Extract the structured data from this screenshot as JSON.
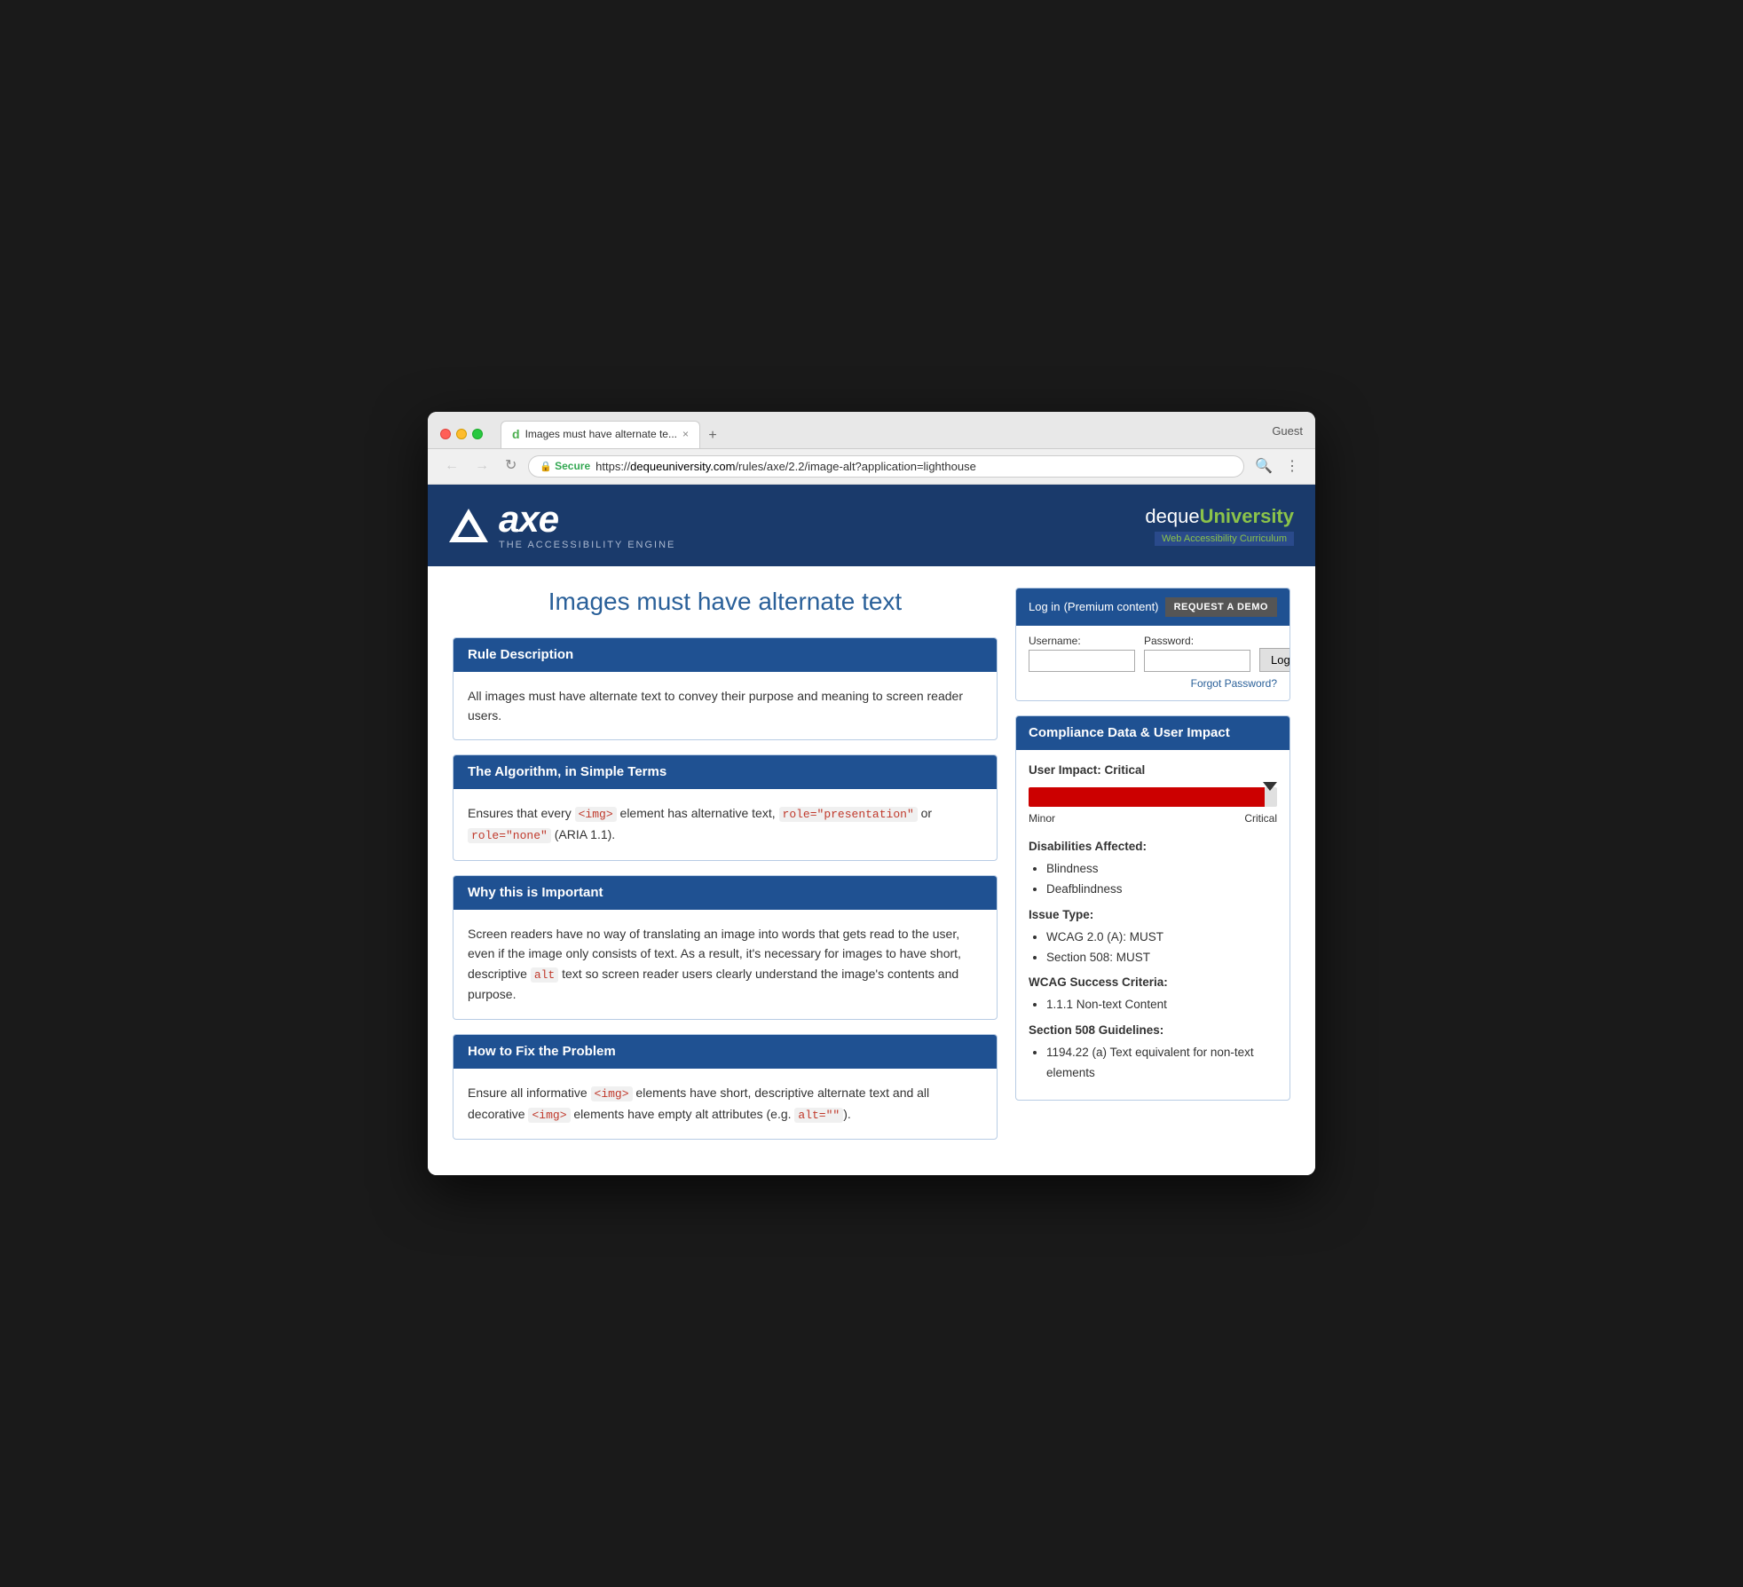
{
  "browser": {
    "tab_title": "Images must have alternate te...",
    "favicon": "d",
    "close_label": "×",
    "guest_label": "Guest",
    "nav_back": "←",
    "nav_forward": "→",
    "nav_refresh": "↻",
    "secure_label": "Secure",
    "url_protocol": "https://",
    "url_domain": "dequeuniversity.com",
    "url_path": "/rules/axe/2.2/image-alt?application=lighthouse",
    "search_icon": "🔍",
    "more_icon": "⋮"
  },
  "header": {
    "logo_alt": "axe - The Accessibility Engine",
    "axe_wordmark": "axe",
    "subtitle": "THE ACCESSIBILITY ENGINE",
    "deque_name_part1": "deque",
    "deque_name_part2": "University",
    "deque_tagline": "Web Accessibility Curriculum"
  },
  "page": {
    "title": "Images must have alternate text"
  },
  "sections": [
    {
      "id": "rule-description",
      "heading": "Rule Description",
      "body": "All images must have alternate text to convey their purpose and meaning to screen reader users."
    },
    {
      "id": "algorithm",
      "heading": "The Algorithm, in Simple Terms",
      "body_parts": [
        "Ensures that every ",
        "<img>",
        " element has alternative text, ",
        "role=\"presentation\"",
        " or ",
        "role=\"none\"",
        " (ARIA 1.1)."
      ]
    },
    {
      "id": "why-important",
      "heading": "Why this is Important",
      "body_parts": [
        "Screen readers have no way of translating an image into words that gets read to the user, even if the image only consists of text. As a result, it's necessary for images to have short, descriptive ",
        "alt",
        " text so screen reader users clearly understand the image's contents and purpose."
      ]
    },
    {
      "id": "how-to-fix",
      "heading": "How to Fix the Problem",
      "body_parts": [
        "Ensure all informative ",
        "<img>",
        " elements have short, descriptive alternate text and all decorative ",
        "<img>",
        " elements have empty alt attributes (e.g. ",
        "alt=\"\"",
        ")."
      ]
    }
  ],
  "login_panel": {
    "title": "Log in",
    "premium_label": "(Premium content)",
    "request_demo_label": "REQUEST A DEMO",
    "username_label": "Username:",
    "password_label": "Password:",
    "login_btn_label": "Login",
    "forgot_password_label": "Forgot Password?"
  },
  "compliance_panel": {
    "heading": "Compliance Data & User Impact",
    "user_impact_label": "User Impact: Critical",
    "impact_level": "Critical",
    "impact_percent": 95,
    "slider_min_label": "Minor",
    "slider_max_label": "Critical",
    "disabilities_heading": "Disabilities Affected:",
    "disabilities": [
      "Blindness",
      "Deafblindness"
    ],
    "issue_type_heading": "Issue Type:",
    "issue_types": [
      "WCAG 2.0 (A): MUST",
      "Section 508: MUST"
    ],
    "wcag_heading": "WCAG Success Criteria:",
    "wcag_items": [
      "1.1.1 Non-text Content"
    ],
    "section508_heading": "Section 508 Guidelines:",
    "section508_items": [
      "1194.22 (a) Text equivalent for non-text elements"
    ]
  }
}
